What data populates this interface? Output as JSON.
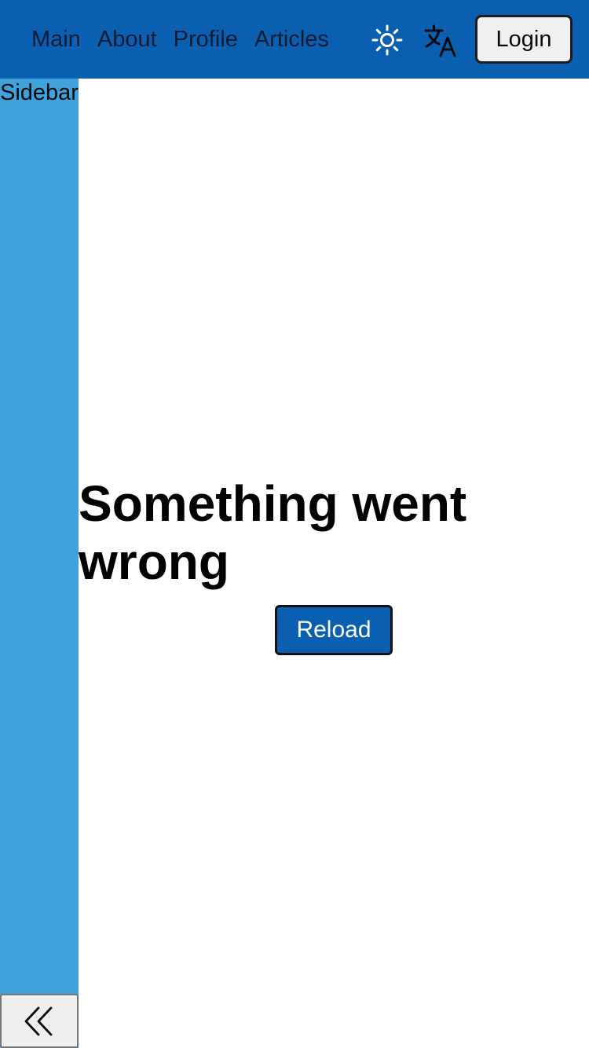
{
  "navbar": {
    "links": [
      "Main",
      "About",
      "Profile",
      "Articles"
    ],
    "theme_icon": "sun-icon",
    "language_icon": "translate-icon",
    "login_label": "Login"
  },
  "sidebar": {
    "label": "Sidebar",
    "collapse_icon": "double-chevron-left-icon"
  },
  "error": {
    "title": "Something went wrong",
    "reload_label": "Reload"
  },
  "colors": {
    "navbar_bg": "#0a5fb0",
    "sidebar_bg": "#41a1d9",
    "primary_button": "#0a5fb0"
  }
}
